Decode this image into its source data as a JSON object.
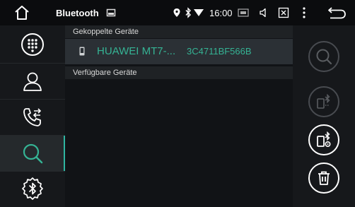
{
  "statusbar": {
    "title": "Bluetooth",
    "time": "16:00"
  },
  "sidebar": {
    "items": [
      {
        "icon": "dialpad-icon"
      },
      {
        "icon": "contacts-icon"
      },
      {
        "icon": "call-log-icon"
      },
      {
        "icon": "search-icon",
        "active": true
      },
      {
        "icon": "bluetooth-settings-icon"
      }
    ]
  },
  "main": {
    "paired_header": "Gekoppelte Geräte",
    "paired_devices": [
      {
        "name": "HUAWEI MT7-...",
        "mac": "3C4711BF566B"
      }
    ],
    "available_header": "Verfügbare Geräte"
  },
  "rightpanel": {
    "buttons": [
      {
        "icon": "search-icon",
        "enabled": false
      },
      {
        "icon": "phone-bluetooth-icon",
        "enabled": false
      },
      {
        "icon": "phone-bluetooth-connect-icon",
        "enabled": true
      },
      {
        "icon": "trash-icon",
        "enabled": true
      }
    ]
  },
  "colors": {
    "accent": "#35b394",
    "background": "#111316",
    "sidebar": "#16181b"
  }
}
